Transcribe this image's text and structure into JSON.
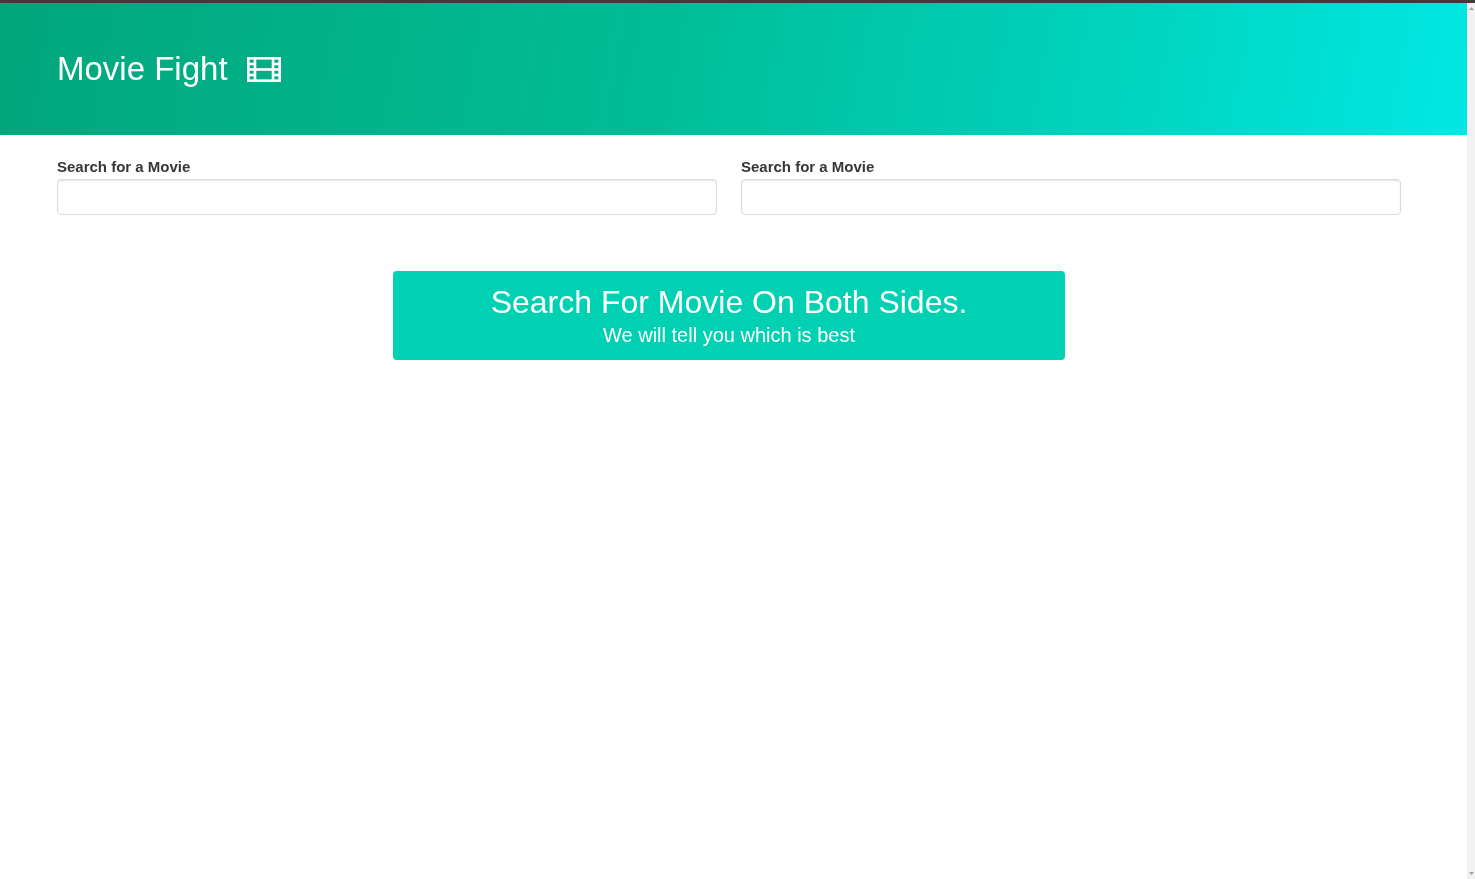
{
  "header": {
    "title": "Movie Fight"
  },
  "search_fields": [
    {
      "label": "Search for a Movie"
    },
    {
      "label": "Search for a Movie"
    }
  ],
  "banner": {
    "title": "Search For Movie On Both Sides.",
    "subtitle": "We will tell you which is best"
  }
}
